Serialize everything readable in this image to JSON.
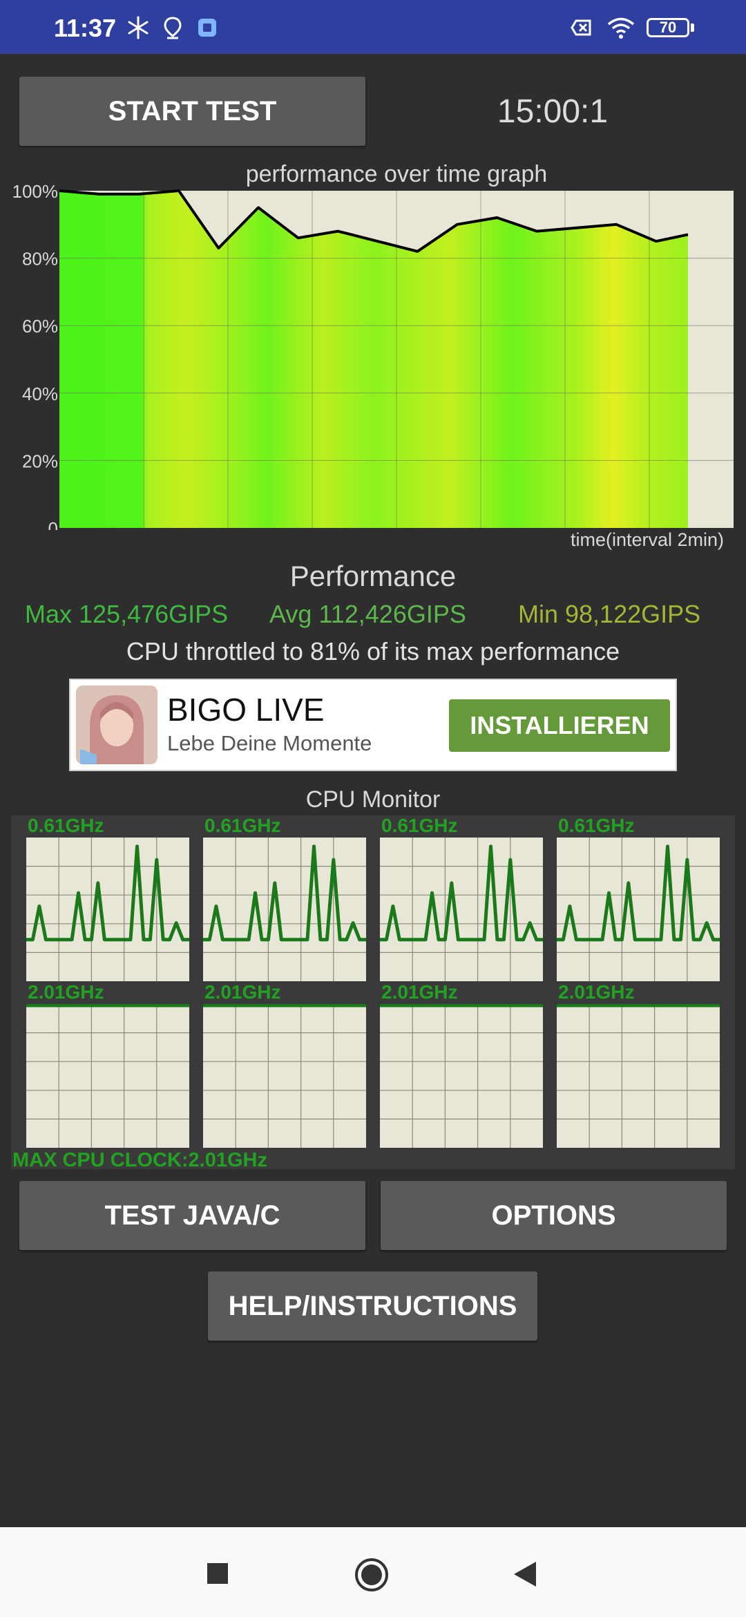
{
  "status_bar": {
    "time": "11:37",
    "battery": "70",
    "icons": [
      "snowflake-icon",
      "location-icon",
      "app-badge-icon",
      "sim-blocked-icon",
      "wifi-icon",
      "battery-icon"
    ]
  },
  "controls": {
    "start_test_label": "START TEST",
    "timer": "15:00:1",
    "test_java_label": "TEST JAVA/C",
    "options_label": "OPTIONS",
    "help_label": "HELP/INSTRUCTIONS"
  },
  "chart_data": [
    {
      "type": "line",
      "title": "performance over time graph",
      "xlabel": "time(interval 2min)",
      "ylabel": "",
      "y_ticks": [
        "100%",
        "80%",
        "60%",
        "40%",
        "20%",
        "0"
      ],
      "ylim": [
        0,
        100
      ],
      "x_gridlines": 8,
      "grid": true,
      "x": [
        0,
        0.5,
        1,
        1.5,
        2,
        2.5,
        3,
        3.5,
        4,
        4.5,
        5,
        5.5,
        6,
        6.5,
        7,
        7.5,
        7.9
      ],
      "series": [
        {
          "values": [
            100,
            99,
            99,
            100,
            83,
            95,
            86,
            88,
            85,
            82,
            90,
            92,
            88,
            89,
            90,
            85,
            87
          ]
        }
      ],
      "colors": {
        "background": "#e8e6d6",
        "fill_high": "#5bf015",
        "fill_mid": "#b0f020",
        "line": "#000000"
      }
    },
    {
      "type": "line",
      "title": "CPU Monitor",
      "cores": [
        {
          "freq": "0.61GHz",
          "values": [
            0,
            0,
            20,
            0,
            0,
            0,
            0,
            0,
            28,
            0,
            0,
            34,
            0,
            0,
            0,
            0,
            0,
            56,
            0,
            0,
            48,
            0,
            0,
            10,
            0,
            0
          ]
        },
        {
          "freq": "0.61GHz",
          "values": [
            0,
            0,
            20,
            0,
            0,
            0,
            0,
            0,
            28,
            0,
            0,
            34,
            0,
            0,
            0,
            0,
            0,
            56,
            0,
            0,
            48,
            0,
            0,
            10,
            0,
            0
          ]
        },
        {
          "freq": "0.61GHz",
          "values": [
            0,
            0,
            20,
            0,
            0,
            0,
            0,
            0,
            28,
            0,
            0,
            34,
            0,
            0,
            0,
            0,
            0,
            56,
            0,
            0,
            48,
            0,
            0,
            10,
            0,
            0
          ]
        },
        {
          "freq": "0.61GHz",
          "values": [
            0,
            0,
            20,
            0,
            0,
            0,
            0,
            0,
            28,
            0,
            0,
            34,
            0,
            0,
            0,
            0,
            0,
            56,
            0,
            0,
            48,
            0,
            0,
            10,
            0,
            0
          ]
        },
        {
          "freq": "2.01GHz",
          "values": [
            100,
            100
          ]
        },
        {
          "freq": "2.01GHz",
          "values": [
            100,
            100
          ]
        },
        {
          "freq": "2.01GHz",
          "values": [
            100,
            100
          ]
        },
        {
          "freq": "2.01GHz",
          "values": [
            100,
            100
          ]
        }
      ],
      "ylim": [
        0,
        100
      ],
      "grid": true,
      "colors": {
        "background": "#e8e6d6",
        "line": "#1a7a1a"
      }
    }
  ],
  "performance": {
    "heading": "Performance",
    "max": "Max 125,476GIPS",
    "avg": "Avg 112,426GIPS",
    "min": "Min 98,122GIPS",
    "throttle": "CPU throttled to 81% of its max performance",
    "colors": {
      "max": "#3fb93f",
      "avg": "#5cb84a",
      "min": "#a6b633"
    }
  },
  "ad": {
    "title": "BIGO LIVE",
    "subtitle": "Lebe Deine Momente",
    "cta": "INSTALLIEREN"
  },
  "cpu_monitor": {
    "max_clock": "MAX CPU CLOCK:2.01GHz"
  }
}
